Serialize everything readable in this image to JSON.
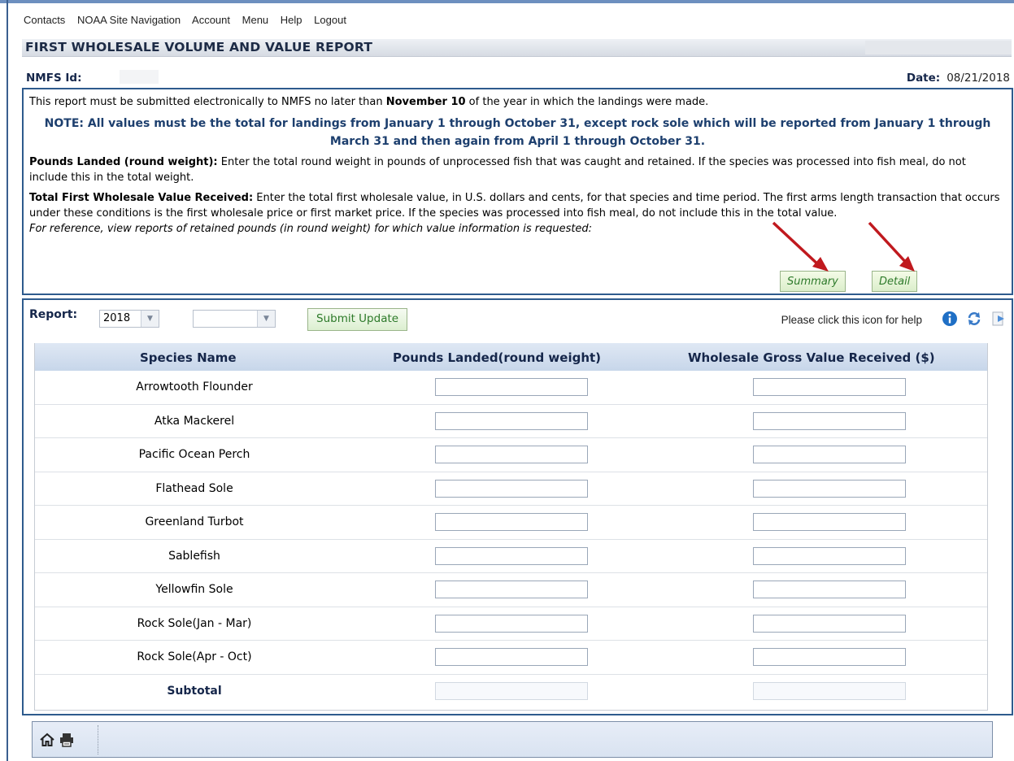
{
  "menu": [
    "Contacts",
    "NOAA Site Navigation",
    "Account",
    "Menu",
    "Help",
    "Logout"
  ],
  "header": {
    "title": "FIRST WHOLESALE VOLUME AND VALUE REPORT"
  },
  "id_row": {
    "nmfs_label": "NMFS Id:",
    "date_label": "Date:",
    "date_value": "08/21/2018"
  },
  "info": {
    "line1_pre": "This report must be submitted electronically to NMFS no later than ",
    "line1_bold": "November 10",
    "line1_post": " of the year in which the landings were made.",
    "note": "NOTE: All values must be the total for landings from January 1 through October 31, except rock sole which will be reported from January 1 through March 31 and then again from April 1 through October 31.",
    "pounds_label": "Pounds Landed (round weight):",
    "pounds_text": " Enter the total round weight in pounds of unprocessed fish that was caught and retained. If the species was processed into fish meal, do not include this in the total weight.",
    "value_label": "Total First Wholesale Value Received:",
    "value_text": " Enter the total first wholesale value, in U.S. dollars and cents, for that species and time period. The first arms length transaction that occurs under these conditions is the first wholesale price or first market price. If the species was processed into fish meal, do not include this in the total value.",
    "reference": "For reference, view reports of retained pounds (in round weight) for which value information is requested:",
    "summary_btn": "Summary",
    "detail_btn": "Detail"
  },
  "report": {
    "label": "Report:",
    "year": "2018",
    "second_select": "",
    "submit": "Submit Update",
    "help_text": "Please click this icon for help"
  },
  "table": {
    "headers": [
      "Species Name",
      "Pounds Landed(round weight)",
      "Wholesale Gross Value Received ($)"
    ],
    "rows": [
      "Arrowtooth Flounder",
      "Atka Mackerel",
      "Pacific Ocean Perch",
      "Flathead Sole",
      "Greenland Turbot",
      "Sablefish",
      "Yellowfin Sole",
      "Rock Sole(Jan - Mar)",
      "Rock Sole(Apr - Oct)",
      "Subtotal"
    ]
  },
  "footer": {
    "icons": [
      "home-icon",
      "print-icon"
    ]
  }
}
